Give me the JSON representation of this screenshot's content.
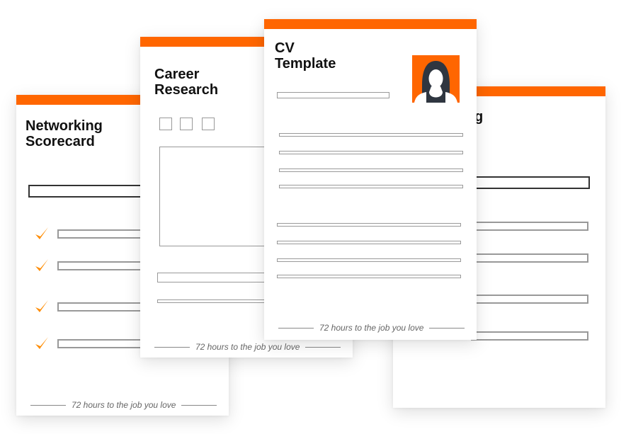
{
  "accent_color": "#ff6600",
  "check_color": "#ff8c00",
  "cards": {
    "networking": {
      "title_line1": "Networking",
      "title_line2": "Scorecard",
      "checklist_count": 4,
      "footer": "72 hours to the job you love"
    },
    "career": {
      "title_line1": "Career",
      "title_line2": "Research",
      "checkbox_count": 3,
      "footer": "72 hours to the job you love"
    },
    "cv": {
      "title_line1": "CV",
      "title_line2": "Template",
      "photo_icon": "woman-avatar-icon",
      "footer": "72 hours to the job you love"
    },
    "back_right": {
      "title_fragment": "g"
    }
  }
}
